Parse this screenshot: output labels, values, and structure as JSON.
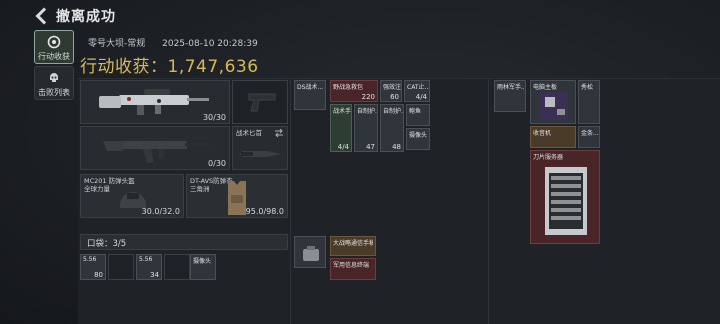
{
  "header": {
    "title": "撤离成功"
  },
  "nav": [
    {
      "label": "行动收获",
      "icon": "loot-icon"
    },
    {
      "label": "击败列表",
      "icon": "skull-icon"
    }
  ],
  "info": {
    "map": "零号大坝-常规",
    "time": "2025-08-10 20:28:39"
  },
  "earnings": {
    "label": "行动收获：",
    "value": "1,747,636"
  },
  "weapons": {
    "primary1_count": "30/30",
    "primary2_count": "0/30",
    "knife_label": "战术匕首"
  },
  "armor": {
    "helmet_label": "MC201 防弹头盔",
    "helmet_sub": "全球力量",
    "helmet_value": "30.0/32.0",
    "vest_label": "DT-AVS防弹衣",
    "vest_sub": "三角洲",
    "vest_value": "95.0/98.0"
  },
  "pocket": {
    "label": "口袋：3/5"
  },
  "pocket_items": [
    {
      "label": "5.56",
      "count": "80"
    },
    {
      "label": "5.56",
      "count": "34"
    },
    {
      "label": "摄像头",
      "count": ""
    }
  ],
  "rig_items": [
    {
      "label": "DS战术...",
      "count": ""
    },
    {
      "label": "野战急救包",
      "count": "220"
    },
    {
      "label": "强效注...",
      "count": "60"
    },
    {
      "label": "CAT止...",
      "count": "4/4"
    },
    {
      "label": "战术手...",
      "count": "4/4"
    },
    {
      "label": "自制护...",
      "count": "47"
    },
    {
      "label": "自制护...",
      "count": "48"
    },
    {
      "label": "鲍鱼",
      "count": ""
    },
    {
      "label": "摄像头",
      "count": ""
    }
  ],
  "backpack_items": [
    {
      "label": "大战略通信手稿"
    },
    {
      "label": "军用信息终端"
    }
  ],
  "safe_items": [
    {
      "label": "雨林军手..."
    },
    {
      "label": "电脑主板"
    },
    {
      "label": "秀松"
    },
    {
      "label": "收音机"
    },
    {
      "label": "金条..."
    },
    {
      "label": "刀片服务器"
    }
  ]
}
